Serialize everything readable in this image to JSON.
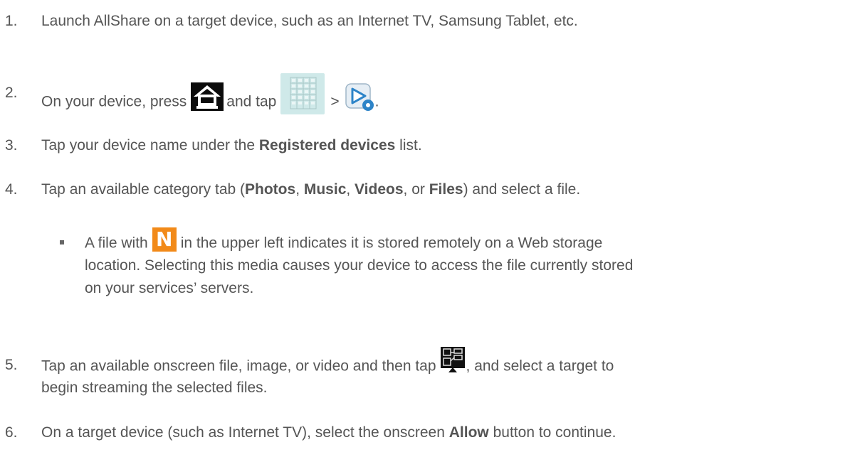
{
  "steps": [
    {
      "num": "1.",
      "text": "Launch AllShare on a target device, such as an Internet TV, Samsung Tablet, etc."
    },
    {
      "num": "2.",
      "part1": "On your device, press",
      "part2": "and tap",
      "part3": ">",
      "part4": ".",
      "icons": [
        "home-icon",
        "apps-icon",
        "allshare-icon"
      ]
    },
    {
      "num": "3.",
      "part1": "Tap your device name under the",
      "bold1": "Registered devices",
      "part2": "list."
    },
    {
      "num": "4.",
      "part1": "Tap an available category tab (",
      "bold1": "Photos",
      "sep1": ", ",
      "bold2": "Music",
      "sep2": ", ",
      "bold3": "Videos",
      "sep3": ", or ",
      "bold4": "Files",
      "part2": ") and select a file."
    },
    {
      "num": "5.",
      "part1": "Tap an available onscreen file, image, or video and then tap",
      "part2": ", and select a target to",
      "line2": "begin streaming the selected files.",
      "icons": [
        "share-icon"
      ]
    },
    {
      "num": "6.",
      "part1": "On a target device (such as Internet TV), select the onscreen",
      "bold1": "Allow",
      "part2": "button to continue."
    }
  ],
  "bullet": {
    "part1": "A file with",
    "icon_letter": "N",
    "part2": "in the upper left indicates it is stored remotely on a Web storage",
    "line2": "location. Selecting this media causes your device to access the file currently stored",
    "line3": "on your services’ servers.",
    "icon_color": "#f28a19"
  },
  "colors": {
    "text": "#555555",
    "apps_icon_bg": "#cfe9e9",
    "allshare_blue": "#2d84c8"
  }
}
